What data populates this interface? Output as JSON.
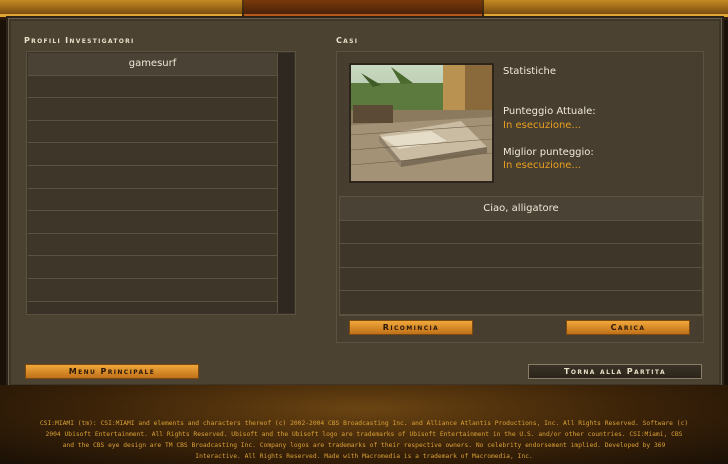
{
  "sections": {
    "profiles_title": "Profili Investigatori",
    "cases_title": "Casi"
  },
  "profiles": {
    "rows": [
      "gamesurf",
      "",
      "",
      "",
      "",
      "",
      "",
      "",
      "",
      "",
      "",
      ""
    ]
  },
  "stats": {
    "title": "Statistiche",
    "current_score_label": "Punteggio Attuale:",
    "current_score_value": "In esecuzione...",
    "best_score_label": "Miglior punteggio:",
    "best_score_value": "In esecuzione..."
  },
  "cases": {
    "rows": [
      "Ciao, alligatore",
      "",
      "",
      "",
      ""
    ]
  },
  "buttons": {
    "restart": "Ricomincia",
    "load": "Carica",
    "main_menu": "Menu Principale",
    "back_to_game": "Torna alla Partita"
  },
  "legal_text": "CSI:MIAMI (tm): CSI:MIAMI and elements and characters thereof (c) 2002-2004 CBS Broadcasting Inc. and Alliance Atlantis Productions, Inc. All Rights Reserved. Software (c) 2004 Ubisoft Entertainment. All Rights Reserved. Ubisoft and the Ubisoft logo are trademarks of Ubisoft Entertainment in the U.S. and/or other countries. CSI:Miami, CBS and the CBS eye design are TM CBS Broadcasting Inc. Company logos are trademarks of their respective owners. No celebrity endorsement implied. Developed by 369 Interactive. All Rights Reserved. Made with Macromedia is a trademark of Macromedia, Inc.",
  "colors": {
    "accent": "#e8a020",
    "panel": "#4b4232",
    "button": "#f0a83a"
  }
}
